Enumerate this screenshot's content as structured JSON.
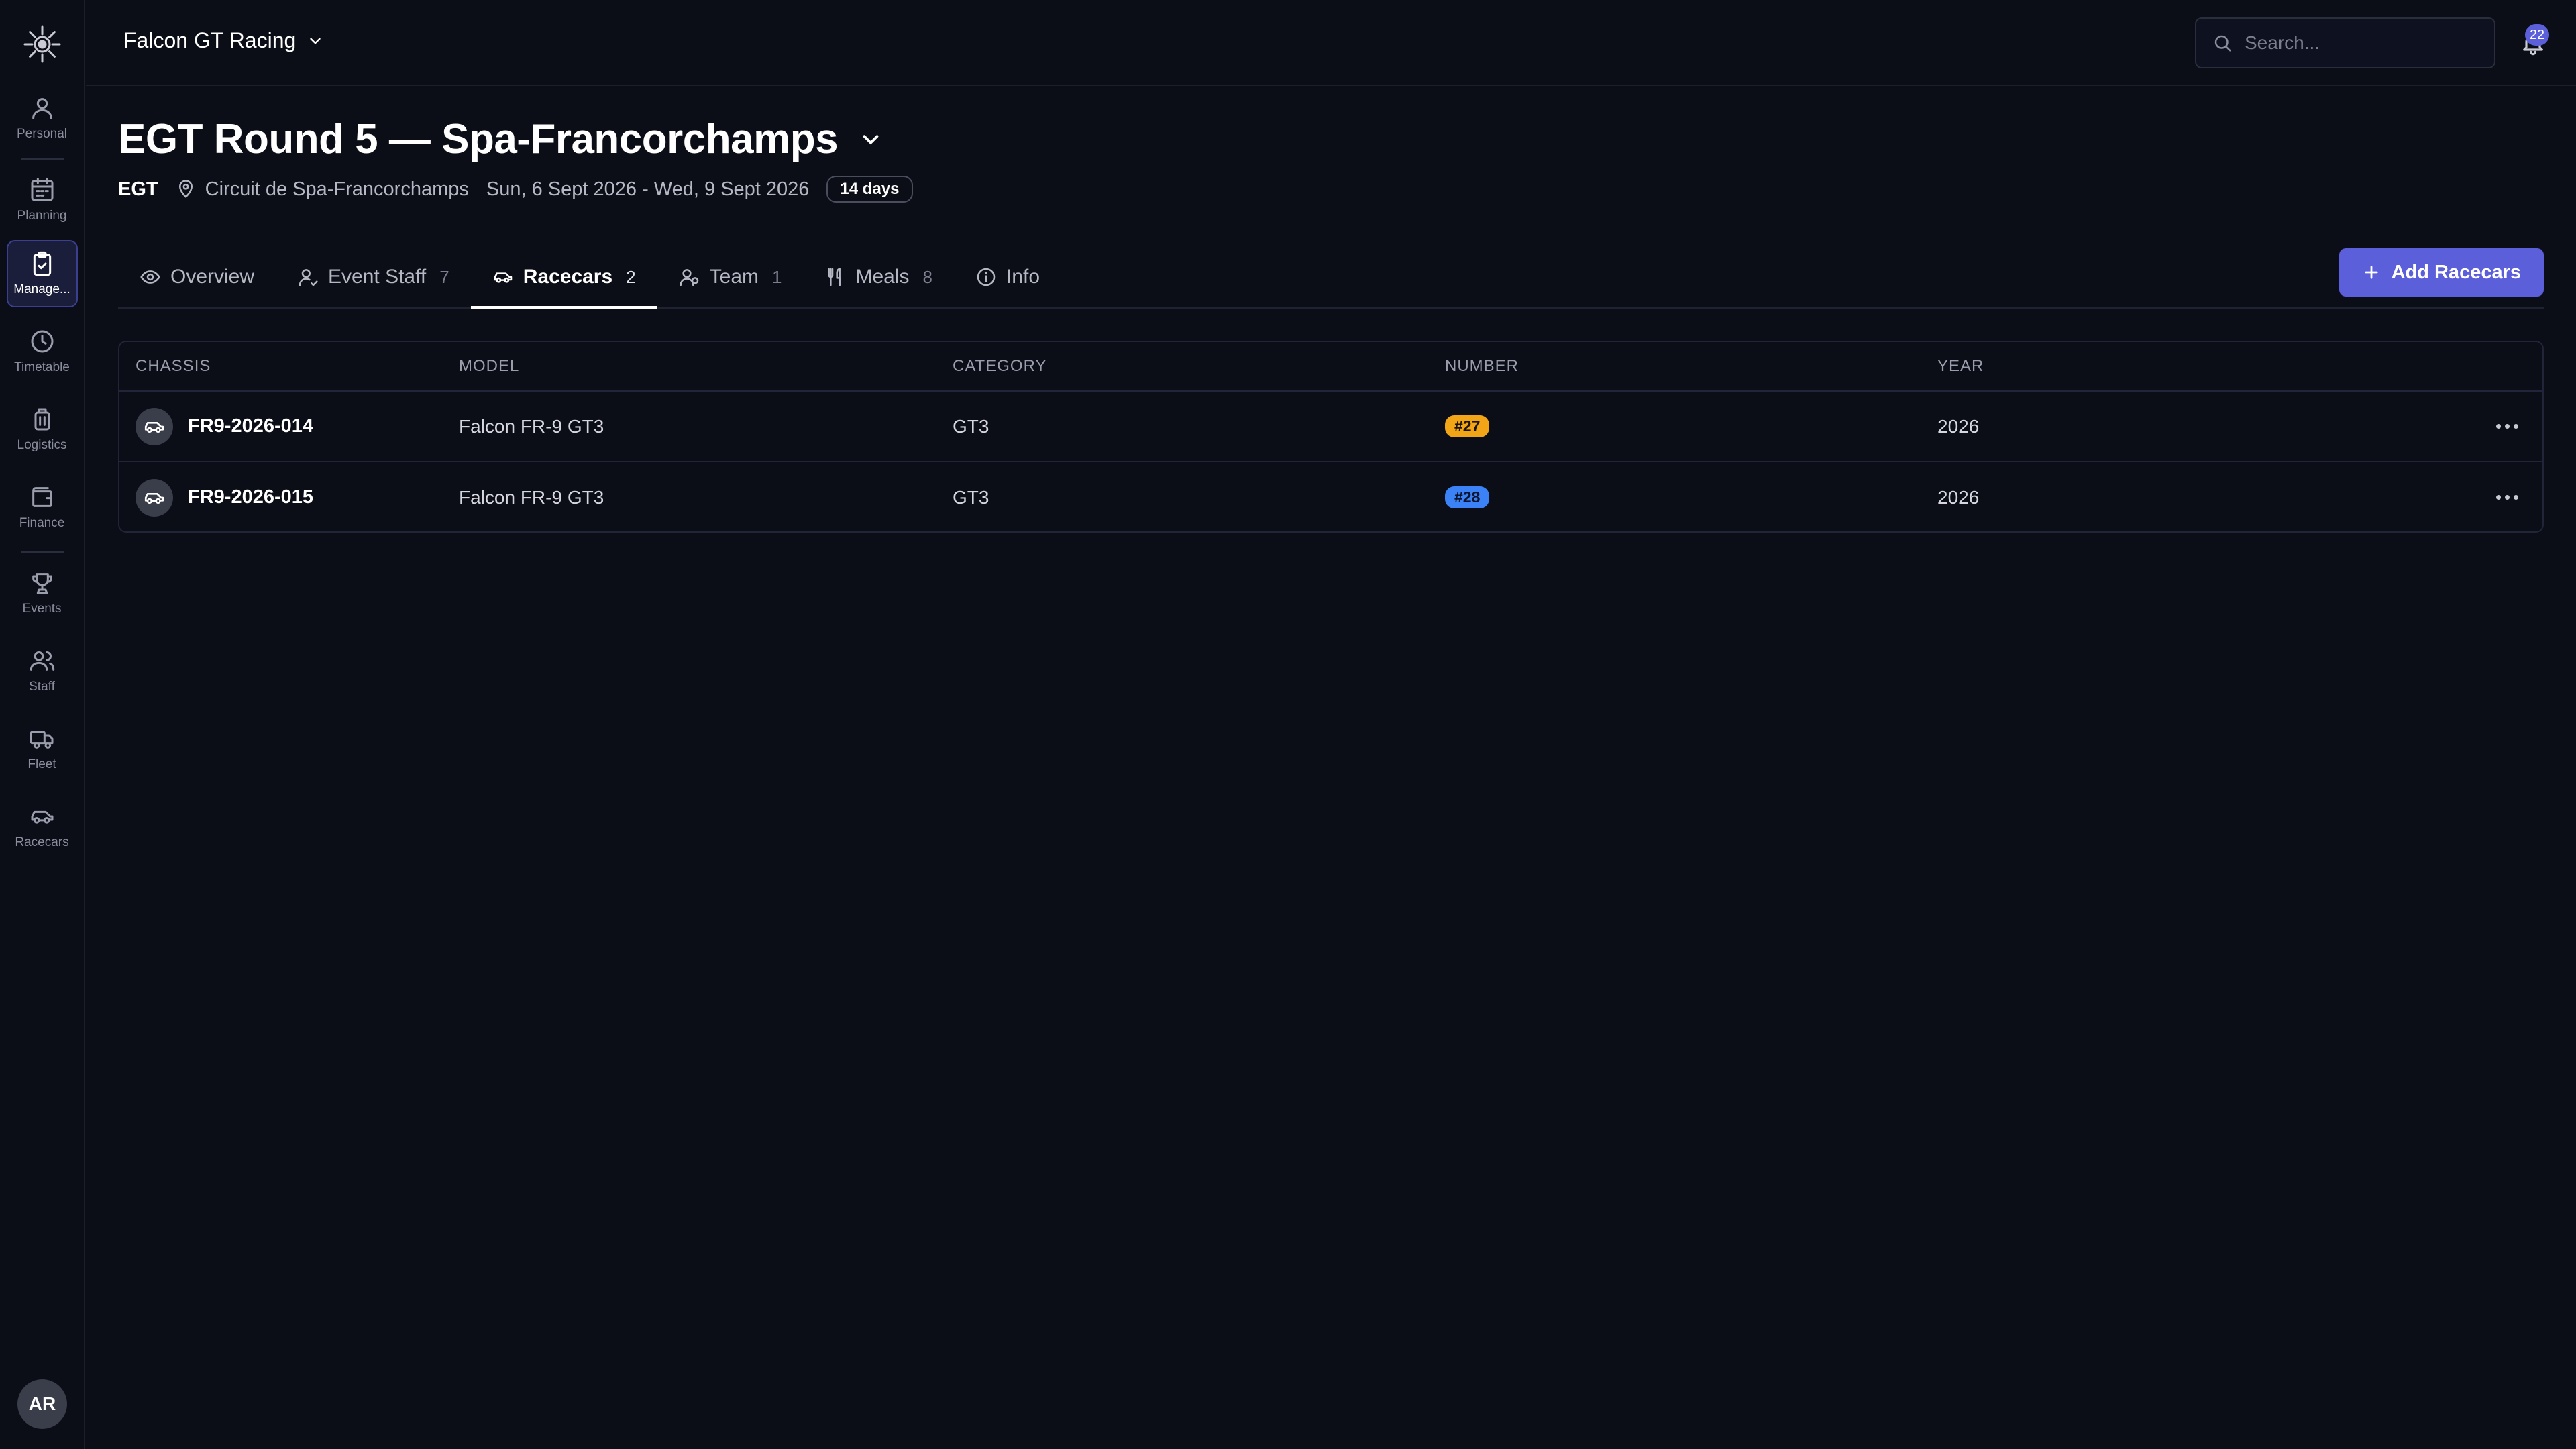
{
  "sidebar": {
    "items": [
      {
        "label": "Personal",
        "icon": "person-icon"
      },
      {
        "label": "Planning",
        "icon": "calendar-icon"
      },
      {
        "label": "Manage...",
        "icon": "clipboard-check-icon",
        "active": true
      },
      {
        "label": "Timetable",
        "icon": "clock-icon"
      },
      {
        "label": "Logistics",
        "icon": "luggage-icon"
      },
      {
        "label": "Finance",
        "icon": "wallet-icon"
      },
      {
        "label": "Events",
        "icon": "trophy-icon"
      },
      {
        "label": "Staff",
        "icon": "users-icon"
      },
      {
        "label": "Fleet",
        "icon": "truck-icon"
      },
      {
        "label": "Racecars",
        "icon": "car-icon"
      }
    ],
    "avatar_initials": "AR"
  },
  "topbar": {
    "org_name": "Falcon GT Racing",
    "search_placeholder": "Search...",
    "notifications_count": "22"
  },
  "header": {
    "title": "EGT Round 5 — Spa-Francorchamps",
    "series": "EGT",
    "location": "Circuit de Spa-Francorchamps",
    "dates": "Sun, 6 Sept 2026 - Wed, 9 Sept 2026",
    "duration": "14 days"
  },
  "tabs": [
    {
      "label": "Overview",
      "count": "",
      "icon": "eye-icon"
    },
    {
      "label": "Event Staff",
      "count": "7",
      "icon": "user-icon"
    },
    {
      "label": "Racecars",
      "count": "2",
      "icon": "car-icon",
      "active": true
    },
    {
      "label": "Team",
      "count": "1",
      "icon": "team-icon"
    },
    {
      "label": "Meals",
      "count": "8",
      "icon": "utensils-icon"
    },
    {
      "label": "Info",
      "count": "",
      "icon": "info-icon"
    }
  ],
  "actions": {
    "add_label": "Add Racecars"
  },
  "table": {
    "columns": [
      "CHASSIS",
      "MODEL",
      "CATEGORY",
      "NUMBER",
      "YEAR"
    ],
    "rows": [
      {
        "chassis": "FR9-2026-014",
        "model": "Falcon FR-9 GT3",
        "category": "GT3",
        "number": "#27",
        "year": "2026"
      },
      {
        "chassis": "FR9-2026-015",
        "model": "Falcon FR-9 GT3",
        "category": "GT3",
        "number": "#28",
        "year": "2026"
      }
    ]
  },
  "colors": {
    "background": "#0b0d17",
    "accent": "#5b5fd9",
    "badge_27": "#f2a516",
    "badge_28": "#3b82f6"
  }
}
